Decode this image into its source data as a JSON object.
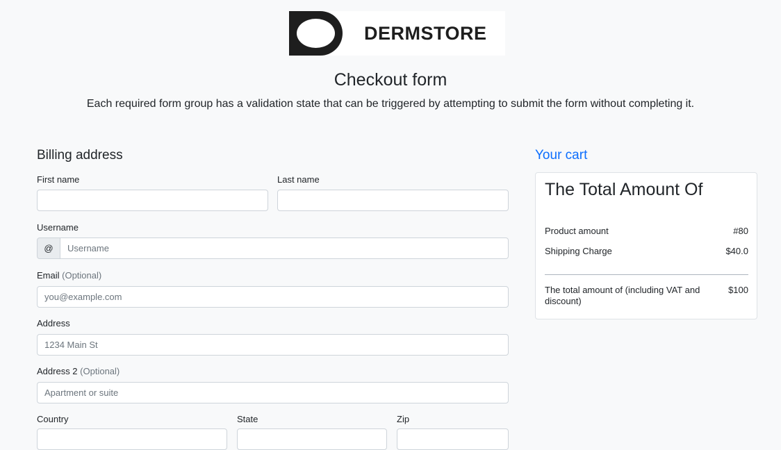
{
  "brand": {
    "name": "DERMSTORE"
  },
  "header": {
    "title": "Checkout form",
    "lead": "Each required form group has a validation state that can be triggered by attempting to submit the form without completing it."
  },
  "billing": {
    "title": "Billing address",
    "first_name": {
      "label": "First name",
      "value": ""
    },
    "last_name": {
      "label": "Last name",
      "value": ""
    },
    "username": {
      "label": "Username",
      "prefix": "@",
      "placeholder": "Username"
    },
    "email": {
      "label": "Email",
      "optional": "(Optional)",
      "placeholder": "you@example.com"
    },
    "address": {
      "label": "Address",
      "placeholder": "1234 Main St"
    },
    "address2": {
      "label": "Address 2",
      "optional": "(Optional)",
      "placeholder": "Apartment or suite"
    },
    "country": {
      "label": "Country"
    },
    "state": {
      "label": "State"
    },
    "zip": {
      "label": "Zip"
    }
  },
  "cart": {
    "title": "Your cart",
    "heading": "The Total Amount Of",
    "rows": [
      {
        "label": "Product amount",
        "value": "#80"
      },
      {
        "label": "Shipping Charge",
        "value": "$40.0"
      }
    ],
    "total": {
      "label": "The total amount of (including VAT and discount)",
      "value": "$100"
    }
  }
}
